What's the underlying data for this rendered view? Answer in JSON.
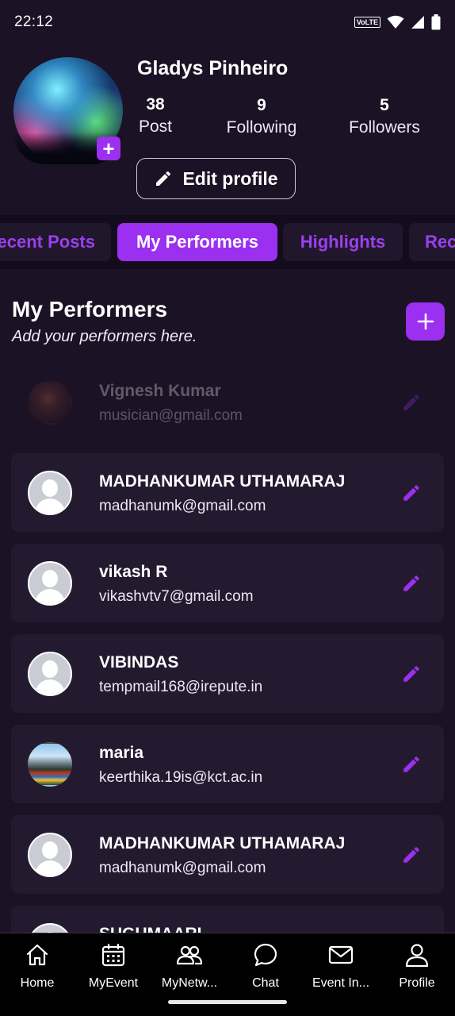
{
  "status_bar": {
    "time": "22:12",
    "network_label": "VoLTE"
  },
  "profile": {
    "name": "Gladys Pinheiro",
    "stats": [
      {
        "value": "38",
        "label": "Post"
      },
      {
        "value": "9",
        "label": "Following"
      },
      {
        "value": "5",
        "label": "Followers"
      }
    ],
    "edit_label": "Edit profile"
  },
  "tabs": [
    {
      "label": "Recent Posts",
      "active": false
    },
    {
      "label": "My Performers",
      "active": true
    },
    {
      "label": "Highlights",
      "active": false
    },
    {
      "label": "Rec",
      "active": false
    }
  ],
  "section": {
    "title": "My Performers",
    "subtitle": "Add your performers here."
  },
  "performers": [
    {
      "name": "Vignesh Kumar",
      "email": "musician@gmail.com"
    },
    {
      "name": "MADHANKUMAR UTHAMARAJ",
      "email": "madhanumk@gmail.com"
    },
    {
      "name": "vikash R",
      "email": "vikashvtv7@gmail.com"
    },
    {
      "name": "VIBINDAS",
      "email": "tempmail168@irepute.in"
    },
    {
      "name": "maria",
      "email": "keerthika.19is@kct.ac.in"
    },
    {
      "name": "MADHANKUMAR UTHAMARAJ",
      "email": "madhanumk@gmail.com"
    },
    {
      "name": "SUGUMAARI",
      "email": ""
    }
  ],
  "bottom_nav": [
    {
      "label": "Home",
      "icon": "home-icon"
    },
    {
      "label": "MyEvent",
      "icon": "calendar-icon"
    },
    {
      "label": "MyNetw...",
      "icon": "people-icon"
    },
    {
      "label": "Chat",
      "icon": "chat-icon"
    },
    {
      "label": "Event In...",
      "icon": "mail-icon"
    },
    {
      "label": "Profile",
      "icon": "person-icon"
    }
  ],
  "colors": {
    "background": "#1b1225",
    "accent": "#9b30f0",
    "card": "#241a30",
    "tab_bar": "#140c1c"
  }
}
